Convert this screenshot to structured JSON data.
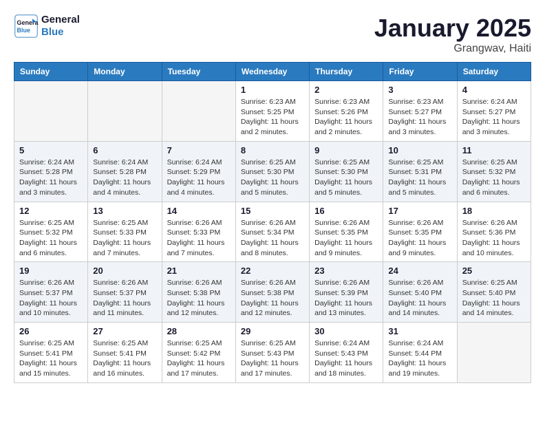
{
  "header": {
    "logo_line1": "General",
    "logo_line2": "Blue",
    "title": "January 2025",
    "subtitle": "Grangwav, Haiti"
  },
  "weekdays": [
    "Sunday",
    "Monday",
    "Tuesday",
    "Wednesday",
    "Thursday",
    "Friday",
    "Saturday"
  ],
  "weeks": [
    {
      "shaded": false,
      "days": [
        {
          "num": "",
          "info": ""
        },
        {
          "num": "",
          "info": ""
        },
        {
          "num": "",
          "info": ""
        },
        {
          "num": "1",
          "info": "Sunrise: 6:23 AM\nSunset: 5:25 PM\nDaylight: 11 hours and 2 minutes."
        },
        {
          "num": "2",
          "info": "Sunrise: 6:23 AM\nSunset: 5:26 PM\nDaylight: 11 hours and 2 minutes."
        },
        {
          "num": "3",
          "info": "Sunrise: 6:23 AM\nSunset: 5:27 PM\nDaylight: 11 hours and 3 minutes."
        },
        {
          "num": "4",
          "info": "Sunrise: 6:24 AM\nSunset: 5:27 PM\nDaylight: 11 hours and 3 minutes."
        }
      ]
    },
    {
      "shaded": true,
      "days": [
        {
          "num": "5",
          "info": "Sunrise: 6:24 AM\nSunset: 5:28 PM\nDaylight: 11 hours and 3 minutes."
        },
        {
          "num": "6",
          "info": "Sunrise: 6:24 AM\nSunset: 5:28 PM\nDaylight: 11 hours and 4 minutes."
        },
        {
          "num": "7",
          "info": "Sunrise: 6:24 AM\nSunset: 5:29 PM\nDaylight: 11 hours and 4 minutes."
        },
        {
          "num": "8",
          "info": "Sunrise: 6:25 AM\nSunset: 5:30 PM\nDaylight: 11 hours and 5 minutes."
        },
        {
          "num": "9",
          "info": "Sunrise: 6:25 AM\nSunset: 5:30 PM\nDaylight: 11 hours and 5 minutes."
        },
        {
          "num": "10",
          "info": "Sunrise: 6:25 AM\nSunset: 5:31 PM\nDaylight: 11 hours and 5 minutes."
        },
        {
          "num": "11",
          "info": "Sunrise: 6:25 AM\nSunset: 5:32 PM\nDaylight: 11 hours and 6 minutes."
        }
      ]
    },
    {
      "shaded": false,
      "days": [
        {
          "num": "12",
          "info": "Sunrise: 6:25 AM\nSunset: 5:32 PM\nDaylight: 11 hours and 6 minutes."
        },
        {
          "num": "13",
          "info": "Sunrise: 6:25 AM\nSunset: 5:33 PM\nDaylight: 11 hours and 7 minutes."
        },
        {
          "num": "14",
          "info": "Sunrise: 6:26 AM\nSunset: 5:33 PM\nDaylight: 11 hours and 7 minutes."
        },
        {
          "num": "15",
          "info": "Sunrise: 6:26 AM\nSunset: 5:34 PM\nDaylight: 11 hours and 8 minutes."
        },
        {
          "num": "16",
          "info": "Sunrise: 6:26 AM\nSunset: 5:35 PM\nDaylight: 11 hours and 9 minutes."
        },
        {
          "num": "17",
          "info": "Sunrise: 6:26 AM\nSunset: 5:35 PM\nDaylight: 11 hours and 9 minutes."
        },
        {
          "num": "18",
          "info": "Sunrise: 6:26 AM\nSunset: 5:36 PM\nDaylight: 11 hours and 10 minutes."
        }
      ]
    },
    {
      "shaded": true,
      "days": [
        {
          "num": "19",
          "info": "Sunrise: 6:26 AM\nSunset: 5:37 PM\nDaylight: 11 hours and 10 minutes."
        },
        {
          "num": "20",
          "info": "Sunrise: 6:26 AM\nSunset: 5:37 PM\nDaylight: 11 hours and 11 minutes."
        },
        {
          "num": "21",
          "info": "Sunrise: 6:26 AM\nSunset: 5:38 PM\nDaylight: 11 hours and 12 minutes."
        },
        {
          "num": "22",
          "info": "Sunrise: 6:26 AM\nSunset: 5:38 PM\nDaylight: 11 hours and 12 minutes."
        },
        {
          "num": "23",
          "info": "Sunrise: 6:26 AM\nSunset: 5:39 PM\nDaylight: 11 hours and 13 minutes."
        },
        {
          "num": "24",
          "info": "Sunrise: 6:26 AM\nSunset: 5:40 PM\nDaylight: 11 hours and 14 minutes."
        },
        {
          "num": "25",
          "info": "Sunrise: 6:25 AM\nSunset: 5:40 PM\nDaylight: 11 hours and 14 minutes."
        }
      ]
    },
    {
      "shaded": false,
      "days": [
        {
          "num": "26",
          "info": "Sunrise: 6:25 AM\nSunset: 5:41 PM\nDaylight: 11 hours and 15 minutes."
        },
        {
          "num": "27",
          "info": "Sunrise: 6:25 AM\nSunset: 5:41 PM\nDaylight: 11 hours and 16 minutes."
        },
        {
          "num": "28",
          "info": "Sunrise: 6:25 AM\nSunset: 5:42 PM\nDaylight: 11 hours and 17 minutes."
        },
        {
          "num": "29",
          "info": "Sunrise: 6:25 AM\nSunset: 5:43 PM\nDaylight: 11 hours and 17 minutes."
        },
        {
          "num": "30",
          "info": "Sunrise: 6:24 AM\nSunset: 5:43 PM\nDaylight: 11 hours and 18 minutes."
        },
        {
          "num": "31",
          "info": "Sunrise: 6:24 AM\nSunset: 5:44 PM\nDaylight: 11 hours and 19 minutes."
        },
        {
          "num": "",
          "info": ""
        }
      ]
    }
  ]
}
